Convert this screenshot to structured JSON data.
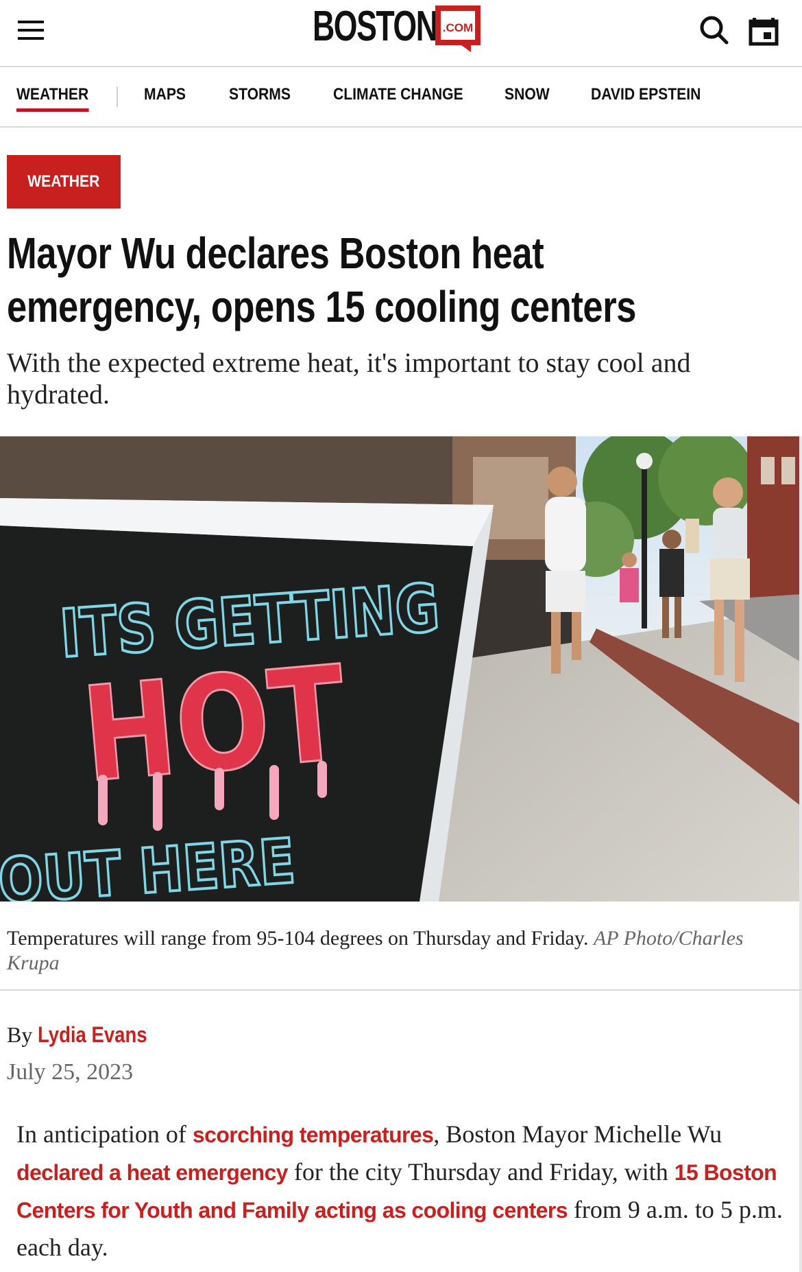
{
  "header": {
    "logo_text": "BOSTON",
    "logo_badge": ".COM",
    "menu_icon": "hamburger-menu-icon",
    "search_icon": "search-icon",
    "calendar_icon": "calendar-icon"
  },
  "nav": {
    "items": [
      {
        "label": "WEATHER",
        "active": true
      },
      {
        "label": "MAPS"
      },
      {
        "label": "STORMS"
      },
      {
        "label": "CLIMATE CHANGE"
      },
      {
        "label": "SNOW"
      },
      {
        "label": "DAVID EPSTEIN"
      }
    ]
  },
  "article": {
    "section_tag": "WEATHER",
    "headline": "Mayor Wu declares Boston heat emergency, opens 15 cooling centers",
    "dek": "With the expected extreme heat, it's important to stay cool and hydrated.",
    "image": {
      "sign_line1": "ITS GETTING",
      "sign_line2": "HOT",
      "sign_line3": "OUT HERE"
    },
    "caption_text": "Temperatures will range from 95-104 degrees on Thursday and Friday.",
    "caption_credit": "AP Photo/Charles Krupa",
    "byline_prefix": "By",
    "author": "Lydia Evans",
    "date": "July 25, 2023",
    "body": {
      "t1": "In anticipation of ",
      "link1": "scorching temperatures",
      "t2": ", Boston Mayor Michelle Wu ",
      "link2": "declared a heat emergency",
      "t3": " for the city Thursday and Friday, with ",
      "link3": "15 Boston Centers for Youth and Family acting as cooling centers",
      "t4": " from 9 a.m. to 5 p.m. each day."
    }
  },
  "colors": {
    "accent_red": "#c8201e",
    "rule_gray": "#d9d9d9"
  }
}
